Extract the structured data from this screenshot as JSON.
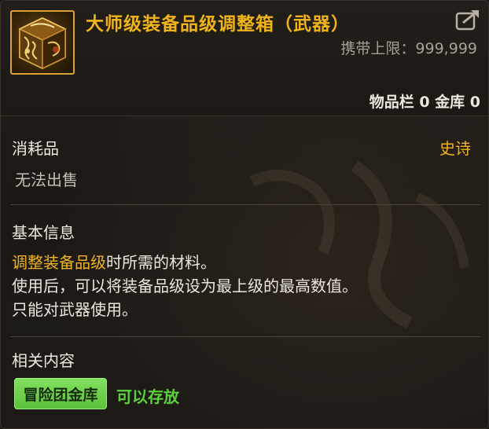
{
  "item": {
    "name": "大师级装备品级调整箱（武器）",
    "carry_limit_label": "携带上限：",
    "carry_limit_value": "999,999",
    "storage_text": "物品栏 0 金库 0",
    "icon": "golden-cube-box-icon"
  },
  "info": {
    "category": "消耗品",
    "rarity": "史诗",
    "sell_status": "无法出售",
    "basic_heading": "基本信息",
    "desc_highlight": "调整装备品级",
    "desc_line1_rest": "时所需的材料。",
    "desc_line2": "使用后，可以将装备品级设为最上级的最高数值。",
    "desc_line3": "只能对武器使用。",
    "related_heading": "相关内容",
    "related_tag": "冒险团金库",
    "related_status": "可以存放"
  },
  "colors": {
    "title_gold": "#f0b419",
    "tag_green": "#6ad046",
    "status_green": "#5bd23a"
  },
  "icons": [
    "share-icon",
    "golden-cube-box-icon"
  ]
}
